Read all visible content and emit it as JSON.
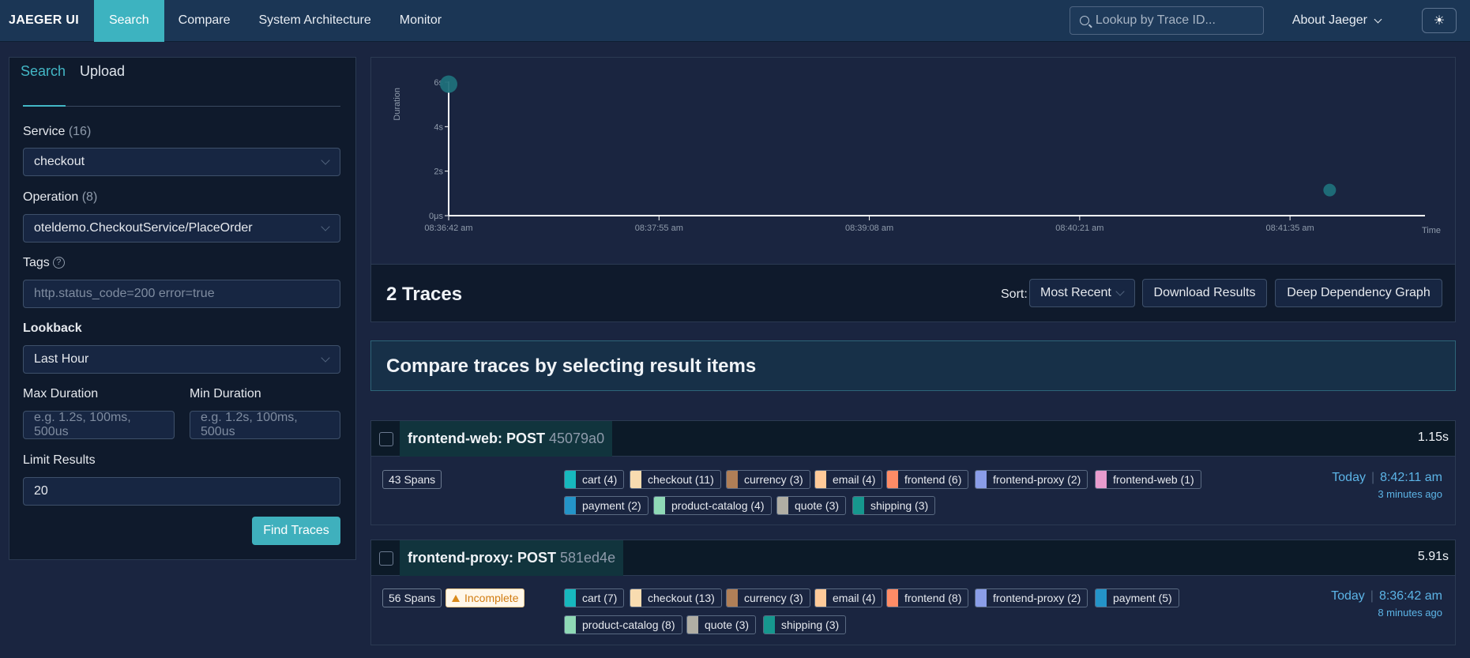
{
  "nav": {
    "brand": "JAEGER UI",
    "items": [
      "Search",
      "Compare",
      "System Architecture",
      "Monitor"
    ],
    "lookup_placeholder": "Lookup by Trace ID...",
    "about": "About Jaeger"
  },
  "search": {
    "tabs": [
      "Search",
      "Upload"
    ],
    "service_label": "Service",
    "service_count": "(16)",
    "service_value": "checkout",
    "operation_label": "Operation",
    "operation_count": "(8)",
    "operation_value": "oteldemo.CheckoutService/PlaceOrder",
    "tags_label": "Tags",
    "tags_placeholder": "http.status_code=200 error=true",
    "lookback_label": "Lookback",
    "lookback_value": "Last Hour",
    "max_duration_label": "Max Duration",
    "max_duration_placeholder": "e.g. 1.2s, 100ms, 500us",
    "min_duration_label": "Min Duration",
    "min_duration_placeholder": "e.g. 1.2s, 100ms, 500us",
    "limit_label": "Limit Results",
    "limit_value": "20",
    "find_button": "Find Traces"
  },
  "chart_data": {
    "type": "scatter",
    "ylabel": "Duration",
    "xlabel": "Time",
    "y_ticks": [
      "0μs",
      "2s",
      "4s",
      "6s"
    ],
    "x_ticks": [
      "08:36:42 am",
      "08:37:55 am",
      "08:39:08 am",
      "08:40:21 am",
      "08:41:35 am"
    ],
    "x_unit": "seconds after 08:36:42 am",
    "x_range": [
      0,
      364
    ],
    "y_range": [
      0,
      6
    ],
    "points": [
      {
        "x": 0,
        "y": 5.91
      },
      {
        "x": 329,
        "y": 1.15
      }
    ],
    "point_color": "#1f6f7a"
  },
  "results": {
    "count_title": "2 Traces",
    "sort_label": "Sort:",
    "sort_value": "Most Recent",
    "download_button": "Download Results",
    "ddg_button": "Deep Dependency Graph",
    "compare_banner": "Compare traces by selecting result items"
  },
  "traces": [
    {
      "service_op": "frontend-web: POST",
      "trace_id": "45079a0",
      "duration": "1.15s",
      "spans": "43 Spans",
      "incomplete": "",
      "services": [
        {
          "name": "cart (4)",
          "color": "#17b8be"
        },
        {
          "name": "checkout (11)",
          "color": "#f8dcb0"
        },
        {
          "name": "currency (3)",
          "color": "#b07f57"
        },
        {
          "name": "email (4)",
          "color": "#ffca99"
        },
        {
          "name": "frontend (6)",
          "color": "#ff8c66"
        },
        {
          "name": "frontend-proxy (2)",
          "color": "#8a9de8"
        },
        {
          "name": "frontend-web (1)",
          "color": "#e89cce"
        },
        {
          "name": "payment (2)",
          "color": "#2494c8"
        },
        {
          "name": "product-catalog (4)",
          "color": "#8fd9b6"
        },
        {
          "name": "quote (3)",
          "color": "#b0aea4"
        },
        {
          "name": "shipping (3)",
          "color": "#16978e"
        }
      ],
      "day": "Today",
      "time": "8:42:11 am",
      "ago": "3 minutes ago"
    },
    {
      "service_op": "frontend-proxy: POST",
      "trace_id": "581ed4e",
      "duration": "5.91s",
      "spans": "56 Spans",
      "incomplete": "Incomplete",
      "services": [
        {
          "name": "cart (7)",
          "color": "#17b8be"
        },
        {
          "name": "checkout (13)",
          "color": "#f8dcb0"
        },
        {
          "name": "currency (3)",
          "color": "#b07f57"
        },
        {
          "name": "email (4)",
          "color": "#ffca99"
        },
        {
          "name": "frontend (8)",
          "color": "#ff8c66"
        },
        {
          "name": "frontend-proxy (2)",
          "color": "#8a9de8"
        },
        {
          "name": "payment (5)",
          "color": "#2494c8"
        },
        {
          "name": "product-catalog (8)",
          "color": "#8fd9b6"
        },
        {
          "name": "quote (3)",
          "color": "#b0aea4"
        },
        {
          "name": "shipping (3)",
          "color": "#16978e"
        }
      ],
      "day": "Today",
      "time": "8:36:42 am",
      "ago": "8 minutes ago"
    }
  ]
}
